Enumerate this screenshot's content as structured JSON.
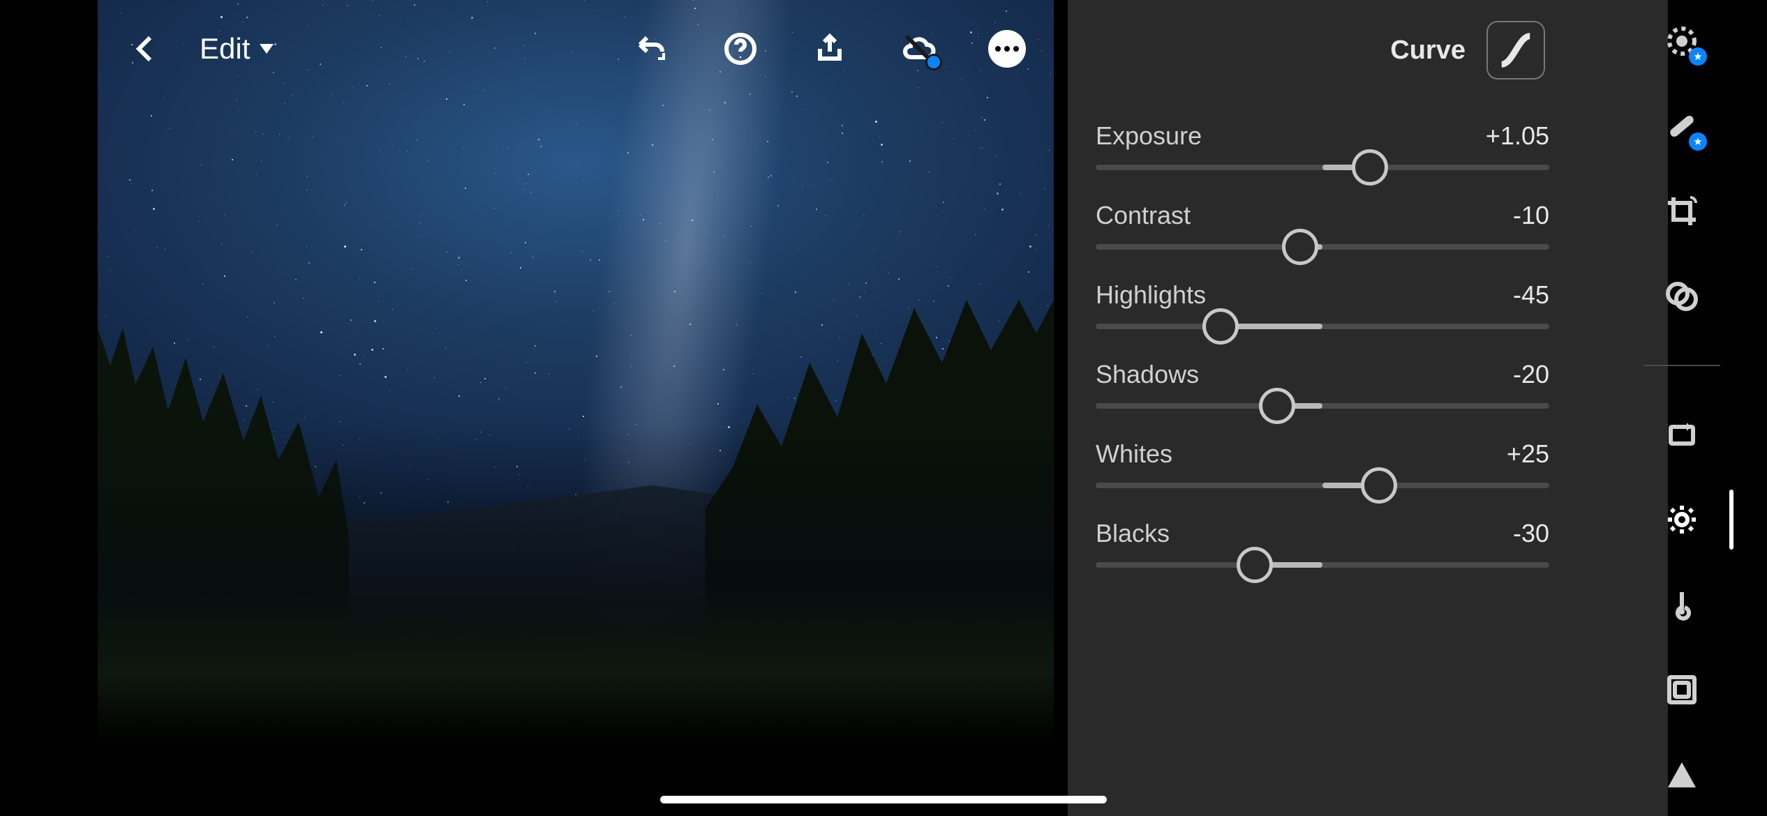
{
  "header": {
    "mode_label": "Edit"
  },
  "light_panel": {
    "curve_label": "Curve",
    "sliders": [
      {
        "key": "exposure",
        "label": "Exposure",
        "value_text": "+1.05",
        "percent": 60.5
      },
      {
        "key": "contrast",
        "label": "Contrast",
        "value_text": "-10",
        "percent": 45.0
      },
      {
        "key": "highlights",
        "label": "Highlights",
        "value_text": "-45",
        "percent": 27.5
      },
      {
        "key": "shadows",
        "label": "Shadows",
        "value_text": "-20",
        "percent": 40.0
      },
      {
        "key": "whites",
        "label": "Whites",
        "value_text": "+25",
        "percent": 62.5
      },
      {
        "key": "blacks",
        "label": "Blacks",
        "value_text": "-30",
        "percent": 35.0
      }
    ]
  },
  "tools": {
    "active": "light"
  }
}
